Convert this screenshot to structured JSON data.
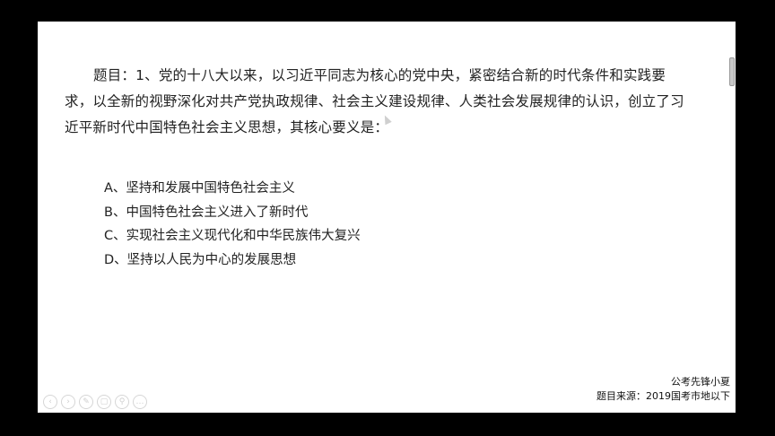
{
  "slide": {
    "question_text": "题目：1、党的十八大以来，以习近平同志为核心的党中央，紧密结合新的时代条件和实践要求，以全新的视野深化对共产党执政规律、社会主义建设规律、人类社会发展规律的认识，创立了习近平新时代中国特色社会主义思想，其核心要义是：",
    "options": [
      "A、坚持和发展中国特色社会主义",
      "B、中国特色社会主义进入了新时代",
      "C、实现社会主义现代化和中华民族伟大复兴",
      "D、坚持以人民为中心的发展思想"
    ],
    "watermark_line1": "公考先锋小夏",
    "watermark_line2": "题目来源：2019国考市地以下"
  },
  "toolbar": {
    "icons": [
      "previous-icon",
      "next-icon",
      "pen-icon",
      "screen-icon",
      "zoom-icon",
      "more-icon"
    ],
    "glyphs": [
      "‹",
      "›",
      "✎",
      "▢",
      "⚲",
      "…"
    ]
  },
  "colors": {
    "background": "#000000",
    "slide": "#ffffff",
    "text": "#222222"
  }
}
